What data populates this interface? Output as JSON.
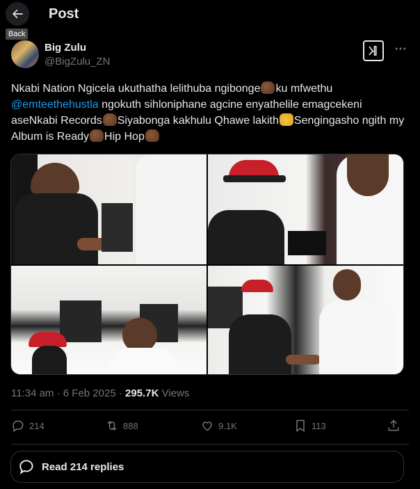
{
  "header": {
    "title": "Post",
    "back_tooltip": "Back"
  },
  "author": {
    "name": "Big Zulu",
    "handle": "@BigZulu_ZN"
  },
  "tweet": {
    "text_1": "Nkabi Nation Ngicela ukuthatha lelithuba ngibonge",
    "text_2": "ku mfwethu ",
    "mention": "@emteethehustla",
    "text_3": " ngokuth sihloniphane agcine enyathelile emagcekeni aseNkabi Records",
    "text_4": "Siyabonga kakhulu Qhawe lakith",
    "text_5": "Sengingasho ngith my Album is Ready",
    "text_6": "Hip Hop"
  },
  "meta": {
    "time": "11:34 am",
    "separator": " · ",
    "date": "6 Feb 2025",
    "views_count": "295.7K",
    "views_label": " Views"
  },
  "actions": {
    "replies": "214",
    "reposts": "888",
    "likes": "9.1K",
    "bookmarks": "113"
  },
  "read_replies": {
    "label": "Read 214 replies"
  },
  "icons": {
    "back": "arrow-left-icon",
    "grok": "grok-icon",
    "more": "more-horizontal-icon",
    "reply": "reply-icon",
    "repost": "repost-icon",
    "like": "heart-icon",
    "bookmark": "bookmark-icon",
    "share": "share-icon",
    "read_replies": "chat-bubble-icon"
  },
  "colors": {
    "background": "#000000",
    "text": "#e7e9ea",
    "secondary_text": "#71767b",
    "link": "#1d9bf0",
    "border": "#2f3336"
  }
}
